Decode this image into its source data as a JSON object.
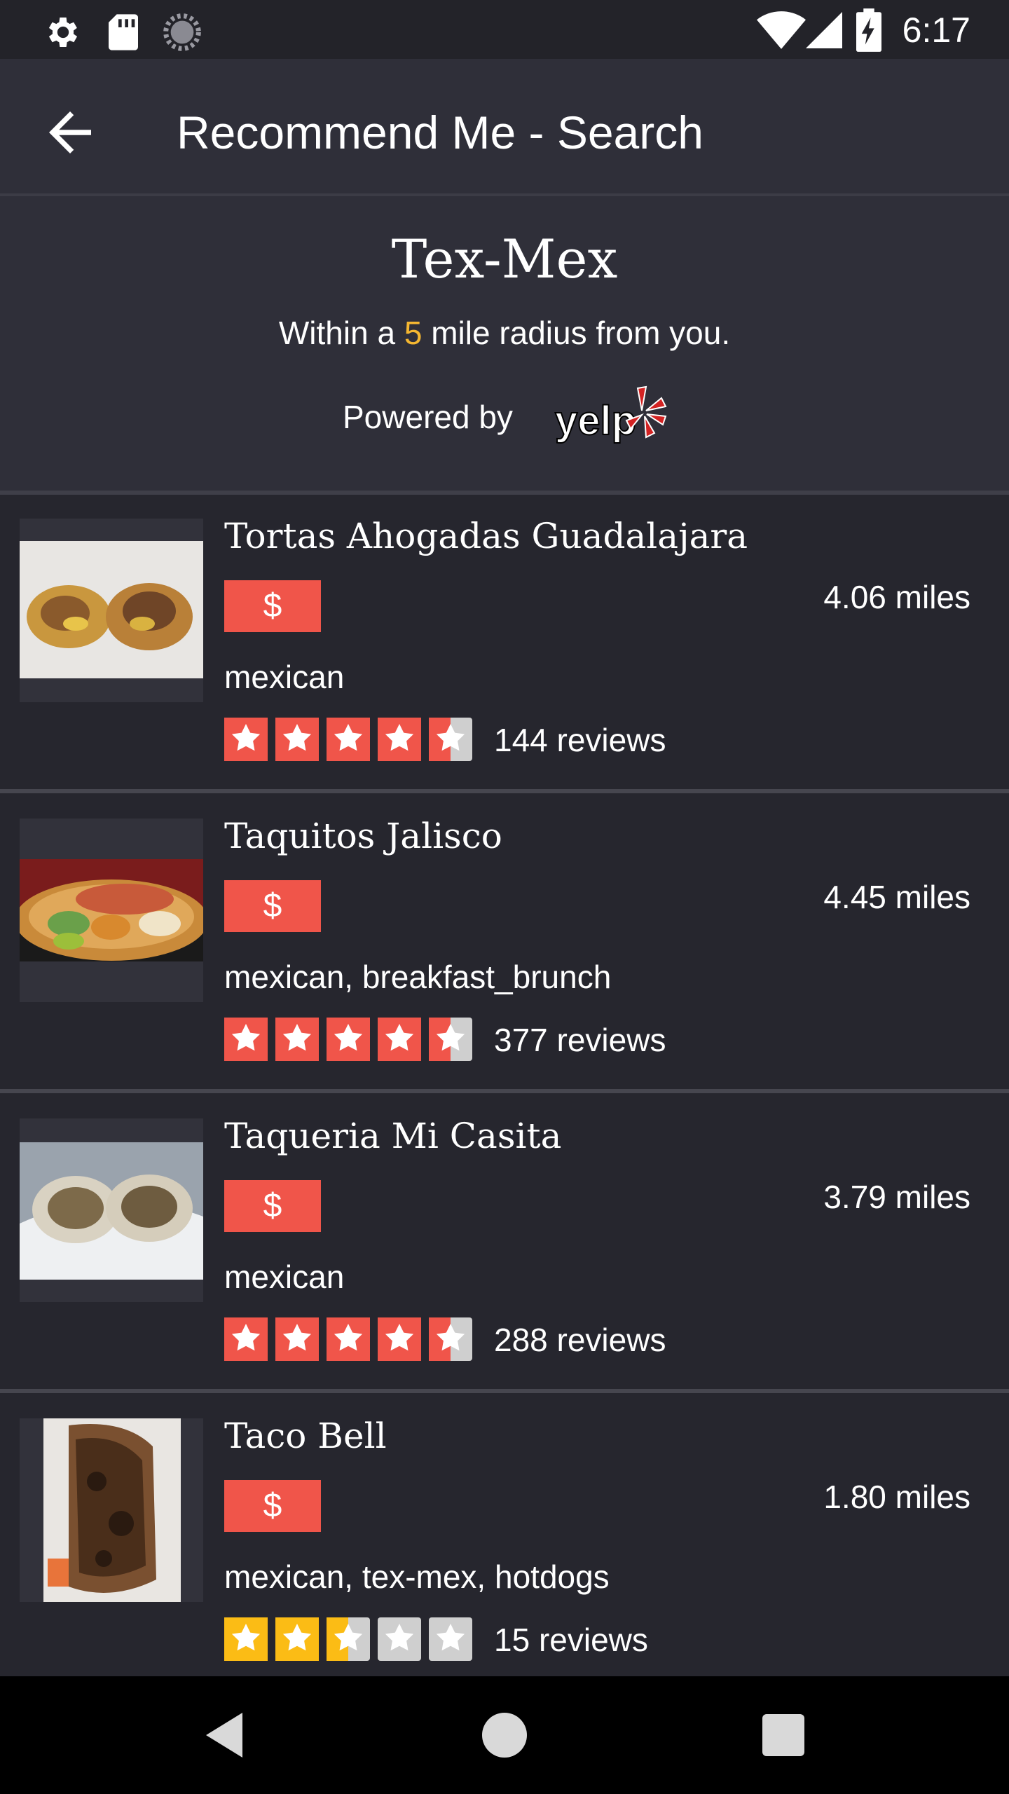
{
  "status_bar": {
    "time": "6:17",
    "icons": [
      "settings-icon",
      "sd-card-icon",
      "loading-icon",
      "wifi-icon",
      "signal-icon",
      "battery-charging-icon"
    ]
  },
  "app_bar": {
    "back_icon": "arrow-back-icon",
    "title": "Recommend Me - Search"
  },
  "search_header": {
    "cuisine": "Tex-Mex",
    "radius_prefix": "Within a ",
    "radius_value": "5",
    "radius_suffix": " mile radius from you.",
    "powered_by": "Powered by",
    "logo_text": "yelp",
    "accent_color": "#f5b731"
  },
  "colors": {
    "price_badge": "#f0554a",
    "star_red": "#f0554a",
    "star_yellow": "#fbbc15",
    "star_empty": "#cfcfcf"
  },
  "restaurants": [
    {
      "name": "Tortas Ahogadas Guadalajara",
      "price": "$",
      "distance": "4.06 miles",
      "categories": "mexican",
      "rating": 4.5,
      "star_color": "red",
      "reviews": "144 reviews"
    },
    {
      "name": "Taquitos Jalisco",
      "price": "$",
      "distance": "4.45 miles",
      "categories": "mexican, breakfast_brunch",
      "rating": 4.5,
      "star_color": "red",
      "reviews": "377 reviews"
    },
    {
      "name": "Taqueria Mi Casita",
      "price": "$",
      "distance": "3.79 miles",
      "categories": "mexican",
      "rating": 4.5,
      "star_color": "red",
      "reviews": "288 reviews"
    },
    {
      "name": "Taco Bell",
      "price": "$",
      "distance": "1.80 miles",
      "categories": "mexican, tex-mex, hotdogs",
      "rating": 2.5,
      "star_color": "yellow",
      "reviews": "15 reviews"
    }
  ],
  "nav_bar": {
    "buttons": [
      "back-triangle-icon",
      "home-circle-icon",
      "recents-square-icon"
    ]
  }
}
